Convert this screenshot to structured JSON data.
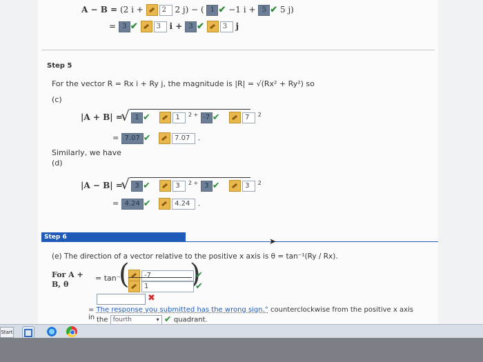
{
  "top_section": {
    "line1_prefix": "A − B =",
    "line1_values": [
      "(2 i +",
      "2",
      "2 j) − (",
      "1",
      "−1 i +",
      "5",
      "5 j)"
    ],
    "line2_prefix": "=",
    "line2_parts": [
      "3",
      "3",
      "i +",
      "3",
      "3",
      "j"
    ]
  },
  "step5": {
    "title": "Step 5",
    "intro": "For the vector R = Rx i + Ry j, the magnitude is |R| = √(Rx² + Ry²) so",
    "part_c": "(c)",
    "sum_label": "|A + B| =",
    "sum_inputs": [
      "1",
      "1",
      "2 +",
      "-7",
      "7",
      "2"
    ],
    "sum_result_label": "=",
    "sum_result_correct": "7.07",
    "sum_result_key": "7.07",
    "similarly": "Similarly, we have",
    "part_d": "(d)",
    "diff_label": "|A − B| =",
    "diff_inputs": [
      "3",
      "3",
      "2 +",
      "3",
      "3",
      "2"
    ],
    "diff_result_label": "=",
    "diff_result_correct": "4.24",
    "diff_result_key": "4.24"
  },
  "step6": {
    "title": "Step 6",
    "part_e": "(e) The direction of a vector relative to the positive x axis is θ = tan⁻¹(Ry / Rx).",
    "for_label_1": "For A +",
    "for_label_2": "B, θ",
    "tan_label": "= tan⁻¹",
    "numerator": "-7",
    "denominator": "1",
    "answer_input": "",
    "feedback_prefix": "=",
    "feedback_text": "The response you submitted has the wrong sign.°",
    "feedback_suffix": "counterclockwise from the positive x axis in",
    "the_label": "the",
    "quadrant_select": "fourth",
    "quadrant_suffix": "quadrant."
  },
  "taskbar": {
    "start_label": "Start"
  },
  "colors": {
    "check": "#2e8b3c",
    "cross": "#d03030",
    "step_bar": "#1e5bb8",
    "feedback": "#1e5bb8"
  }
}
